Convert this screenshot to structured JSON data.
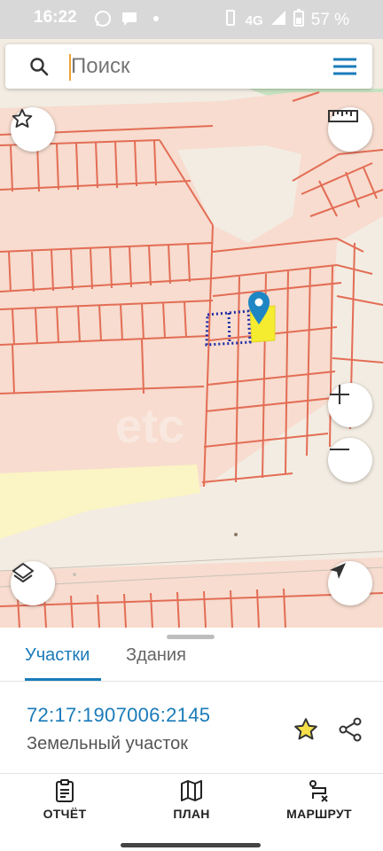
{
  "status_bar": {
    "time": "16:22",
    "network": "4G",
    "battery": "57 %"
  },
  "search": {
    "placeholder": "Поиск",
    "icon": "search-icon",
    "menu_icon": "hamburger-menu-icon"
  },
  "map": {
    "parcel_colors": {
      "outline": "#e36d55",
      "fill": "#f7dccf",
      "selected_fill": "#f5ec2f",
      "highlight_dots": "#1f2ba8",
      "marker": "#1f86c4"
    },
    "controls": {
      "favorite_icon": "star-outline-icon",
      "ruler_icon": "ruler-icon",
      "zoom_in": "+",
      "zoom_out": "−",
      "layers_icon": "layers-icon",
      "locate_icon": "navigation-arrow-icon"
    }
  },
  "sheet": {
    "tabs": [
      {
        "label": "Участки",
        "active": true
      },
      {
        "label": "Здания",
        "active": false
      }
    ],
    "parcel": {
      "number": "72:17:1907006:2145",
      "type": "Земельный участок"
    },
    "accent_color": "#1a7bb9"
  },
  "bottom_nav": [
    {
      "label": "ОТЧЁТ",
      "icon": "report-clipboard-icon"
    },
    {
      "label": "ПЛАН",
      "icon": "map-plan-icon"
    },
    {
      "label": "МАРШРУТ",
      "icon": "route-icon"
    }
  ]
}
